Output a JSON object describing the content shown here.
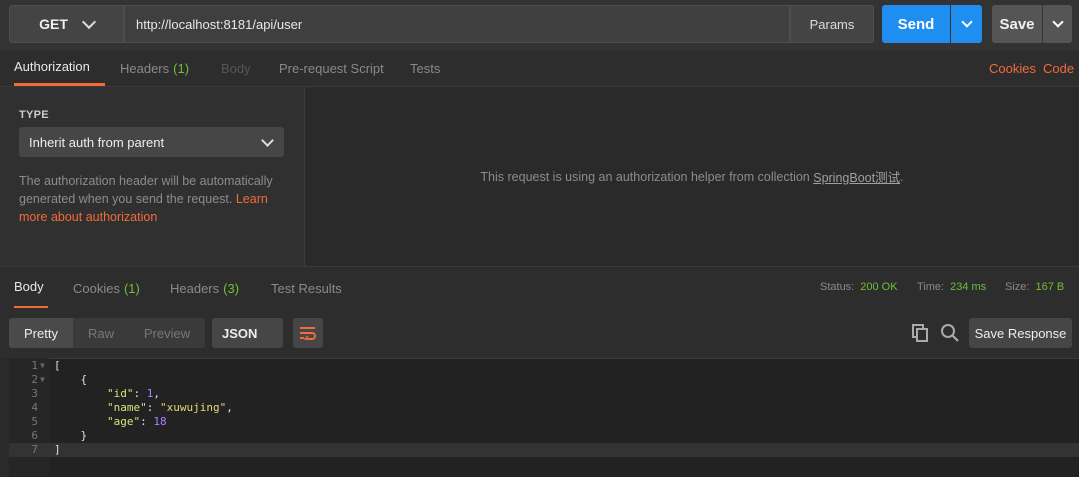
{
  "request": {
    "method": "GET",
    "url": "http://localhost:8181/api/user",
    "params_label": "Params",
    "send_label": "Send",
    "save_label": "Save"
  },
  "request_tabs": [
    {
      "label": "Authorization",
      "count": ""
    },
    {
      "label": "Headers",
      "count": "(1)"
    },
    {
      "label": "Body",
      "count": ""
    },
    {
      "label": "Pre-request Script",
      "count": ""
    },
    {
      "label": "Tests",
      "count": ""
    }
  ],
  "request_links": {
    "cookies": "Cookies",
    "code": "Code"
  },
  "auth": {
    "type_label": "TYPE",
    "selected": "Inherit auth from parent",
    "description": "The authorization header will be automatically generated when you send the request.",
    "learn_more": "Learn more about authorization",
    "helper_prefix": "This request is using an authorization helper from collection ",
    "collection": "SpringBoot测试",
    "helper_suffix": "."
  },
  "response_tabs": [
    {
      "label": "Body",
      "count": ""
    },
    {
      "label": "Cookies",
      "count": "(1)"
    },
    {
      "label": "Headers",
      "count": "(3)"
    },
    {
      "label": "Test Results",
      "count": ""
    }
  ],
  "status": {
    "status_label": "Status:",
    "status_value": "200 OK",
    "time_label": "Time:",
    "time_value": "234 ms",
    "size_label": "Size:",
    "size_value": "167 B"
  },
  "view_modes": [
    "Pretty",
    "Raw",
    "Preview"
  ],
  "format": "JSON",
  "save_response_label": "Save Response",
  "code_lines": [
    {
      "num": "1",
      "text": "["
    },
    {
      "num": "2",
      "text": "    {"
    },
    {
      "num": "3",
      "key": "\"id\"",
      "sep": ": ",
      "val": "1",
      "vtype": "n",
      "end": ","
    },
    {
      "num": "4",
      "key": "\"name\"",
      "sep": ": ",
      "val": "\"xuwujing\"",
      "vtype": "s",
      "end": ","
    },
    {
      "num": "5",
      "key": "\"age\"",
      "sep": ": ",
      "val": "18",
      "vtype": "n",
      "end": ""
    },
    {
      "num": "6",
      "text": "    }"
    },
    {
      "num": "7",
      "text": "]"
    }
  ],
  "colors": {
    "accent": "#f26b3a",
    "send": "#1e8ef0",
    "count": "#6fbf3a"
  }
}
